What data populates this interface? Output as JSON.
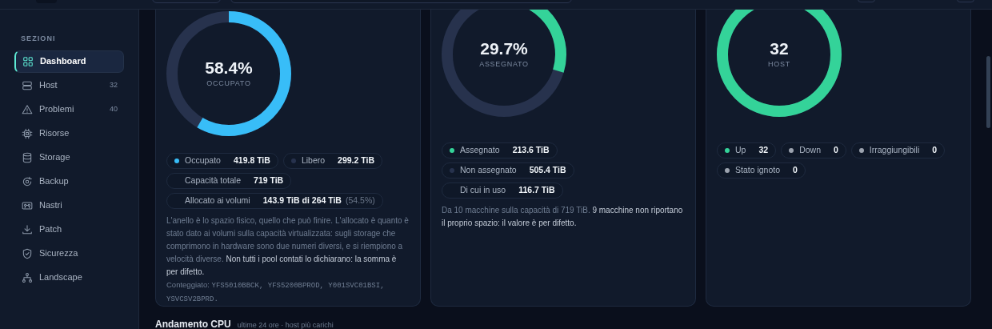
{
  "sidebar": {
    "heading": "SEZIONI",
    "items": [
      {
        "label": "Dashboard",
        "selected": true
      },
      {
        "label": "Host",
        "count": "32",
        "selected": false
      },
      {
        "label": "Problemi",
        "count": "40",
        "selected": false
      },
      {
        "label": "Risorse",
        "selected": false
      },
      {
        "label": "Storage",
        "selected": false
      },
      {
        "label": "Backup",
        "selected": false
      },
      {
        "label": "Nastri",
        "selected": false
      },
      {
        "label": "Patch",
        "selected": false
      },
      {
        "label": "Sicurezza",
        "selected": false
      },
      {
        "label": "Landscape",
        "selected": false
      }
    ]
  },
  "cards": [
    {
      "ring": {
        "value": "58.4%",
        "label": "OCCUPATO",
        "level": 0.584,
        "color": "#38bdf8"
      },
      "legend": [
        [
          {
            "label": "Occupato",
            "value": "419.8 TiB",
            "color": "#38bdf8"
          },
          {
            "label": "Libero",
            "value": "299.2 TiB",
            "color": "#27324d"
          }
        ],
        [
          {
            "label": "Capacità totale",
            "value": "719 TiB"
          }
        ],
        [
          {
            "label": "Allocato ai volumi",
            "value": "143.9 TiB di 264 TiB",
            "extra": "(54.5%)"
          }
        ]
      ],
      "note": [
        {
          "text": "L'anello è lo spazio fisico, quello che può finire. L'allocato è quanto è stato dato ai volumi sulla capacità virtualizzata: sugli storage che comprimono in hardware sono due numeri diversi, e si riempiono a velocità diverse.",
          "strong": false
        },
        {
          "text": "Non tutti i pool contati lo dichiarano: la somma è per difetto.",
          "strong": true
        }
      ],
      "counted": {
        "label": "Conteggiato:",
        "items": "YFS5010BBCK, YFS5200BPROD, Y001SVC01BSI, YSVCSV2BPRD."
      }
    },
    {
      "ring": {
        "value": "29.7%",
        "label": "ASSEGNATO",
        "color": "#34d399"
      },
      "legend": [
        [
          {
            "label": "Assegnato",
            "value": "213.6 TiB",
            "color": "#34d399"
          }
        ],
        [
          {
            "label": "Non assegnato",
            "value": "505.4 TiB",
            "color": "#27324d"
          }
        ],
        [
          {
            "label": "Di cui in uso",
            "value": "116.7 TiB"
          }
        ]
      ],
      "note": [
        {
          "text": "Da 10 macchine sulla capacità di 719 TiB.",
          "strong": false
        },
        {
          "text": "9 macchine non riportano il proprio spazio: il valore è per difetto.",
          "strong": true
        }
      ]
    },
    {
      "ring": {
        "value": "32",
        "label": "HOST",
        "color": "#34d399"
      },
      "legend": [
        [
          {
            "label": "Up",
            "value": "32",
            "color": "#34d399"
          },
          {
            "label": "Down",
            "value": "0",
            "color": "#9ca3af"
          },
          {
            "label": "Irraggiungibili",
            "value": "0",
            "color": "#9ca3af"
          }
        ],
        [
          {
            "label": "Stato ignoto",
            "value": "0",
            "color": "#9ca3af"
          }
        ]
      ]
    }
  ],
  "section": {
    "title": "Andamento CPU",
    "subtitle": "ultime 24 ore · host più carichi"
  }
}
